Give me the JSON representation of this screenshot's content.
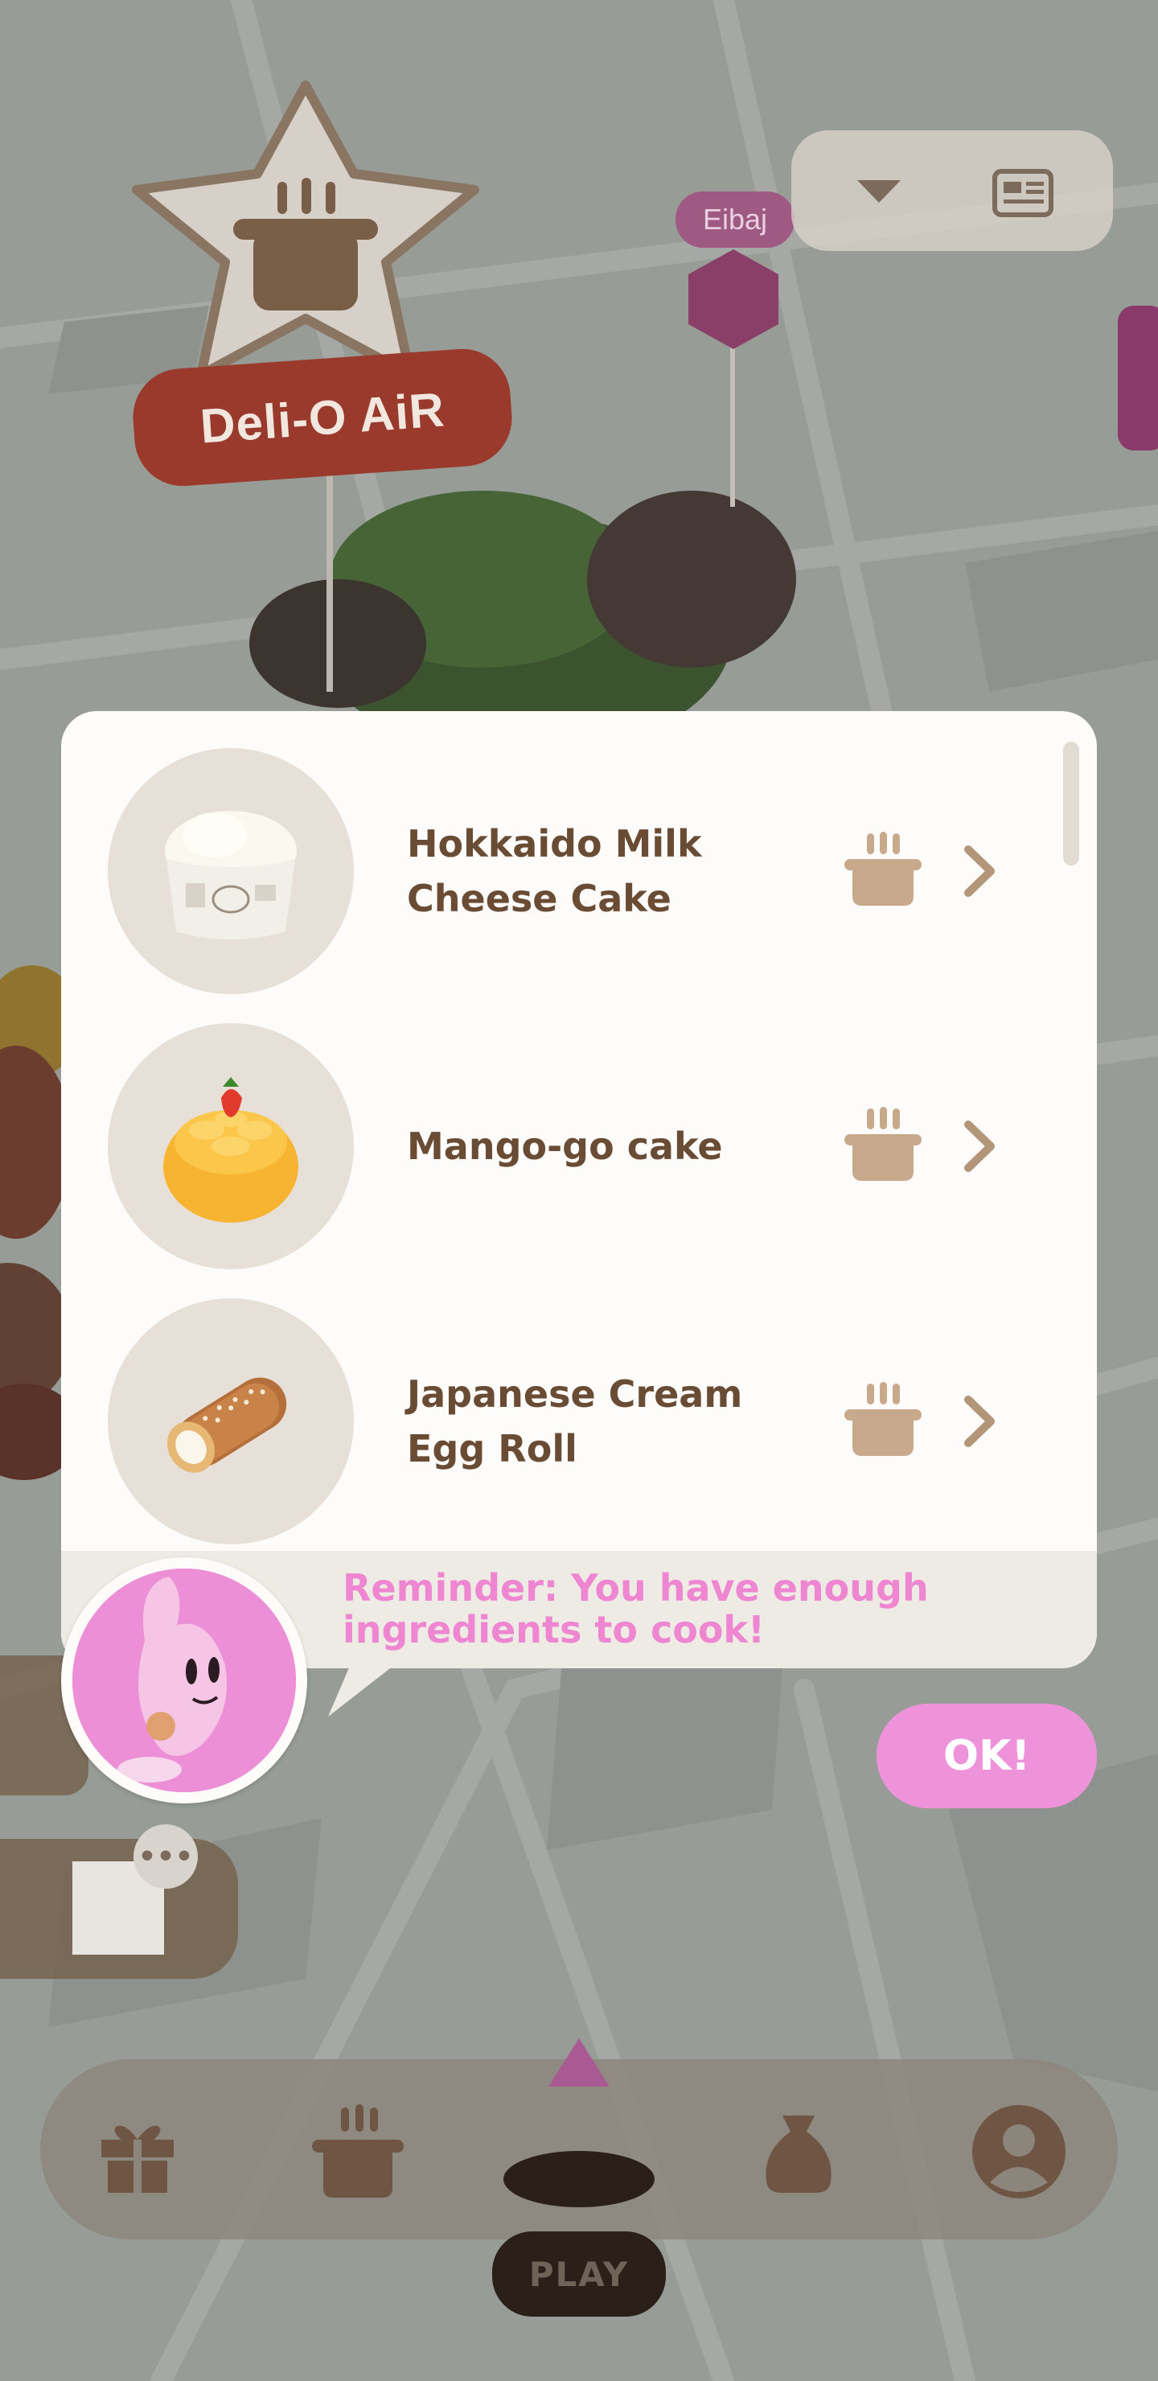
{
  "map": {
    "store_sign": "Deli-O AiR",
    "nearby_tag": "Eibaj"
  },
  "recipes": [
    {
      "name": "Hokkaido Milk\nCheese Cake",
      "image": "milk-cheese-cake-cup"
    },
    {
      "name": "Mango-go cake",
      "image": "mango-cake"
    },
    {
      "name": "Japanese Cream\nEgg Roll",
      "image": "cream-egg-roll"
    }
  ],
  "reminder": {
    "text": "Reminder: You have enough\ningredients to cook!"
  },
  "ok_button": {
    "label": "OK!"
  },
  "bottom_nav": {
    "play_label": "PLAY",
    "icons": [
      "gift-icon",
      "pot-icon",
      "play-pin-icon",
      "bag-icon",
      "profile-icon"
    ]
  },
  "colors": {
    "accent_pink": "#ee93da",
    "reminder_pink": "#ee86d2",
    "recipe_text": "#6a4b33",
    "pot_brown": "#c8a98c",
    "store_red": "#9a3a2c"
  }
}
